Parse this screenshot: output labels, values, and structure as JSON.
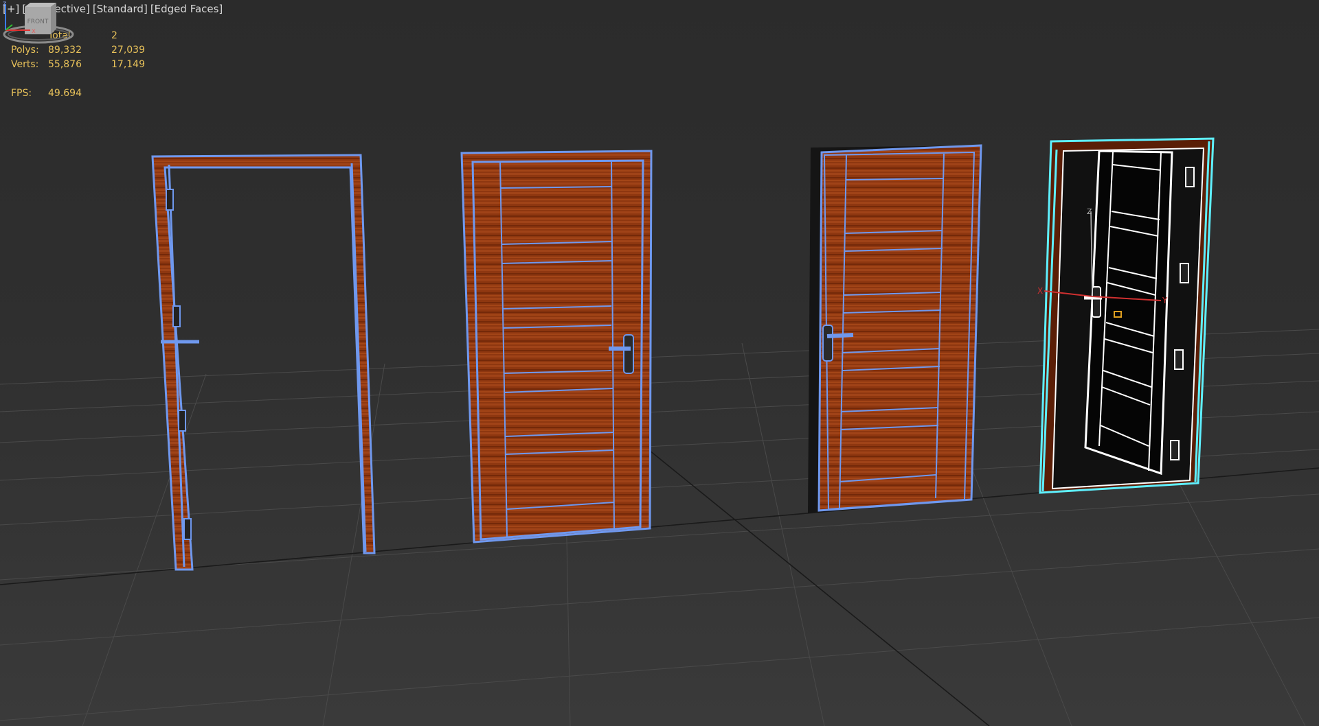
{
  "viewport": {
    "labels": [
      "[+]",
      "[Perspective]",
      "[Standard]",
      "[Edged Faces]"
    ],
    "stats": {
      "header": [
        "",
        "Total",
        "2"
      ],
      "polys": [
        "Polys:",
        "89,332",
        "27,039"
      ],
      "verts": [
        "Verts:",
        "55,876",
        "17,149"
      ],
      "fps": [
        "FPS:",
        "49.694"
      ]
    },
    "viewcube_label": "FRONT",
    "gizmo": {
      "x_label": "X",
      "y_label": "Y",
      "z_label": "Z"
    },
    "tripod": {
      "x_label": "x",
      "z_label": "z"
    }
  },
  "colors": {
    "background": "#2e2e2e",
    "grid": "#464646",
    "wood": "#9a3c10",
    "wireframe_blue": "#6f98ee",
    "selection_cyan": "#5ef0ff",
    "stats_yellow": "#e8c25a"
  }
}
